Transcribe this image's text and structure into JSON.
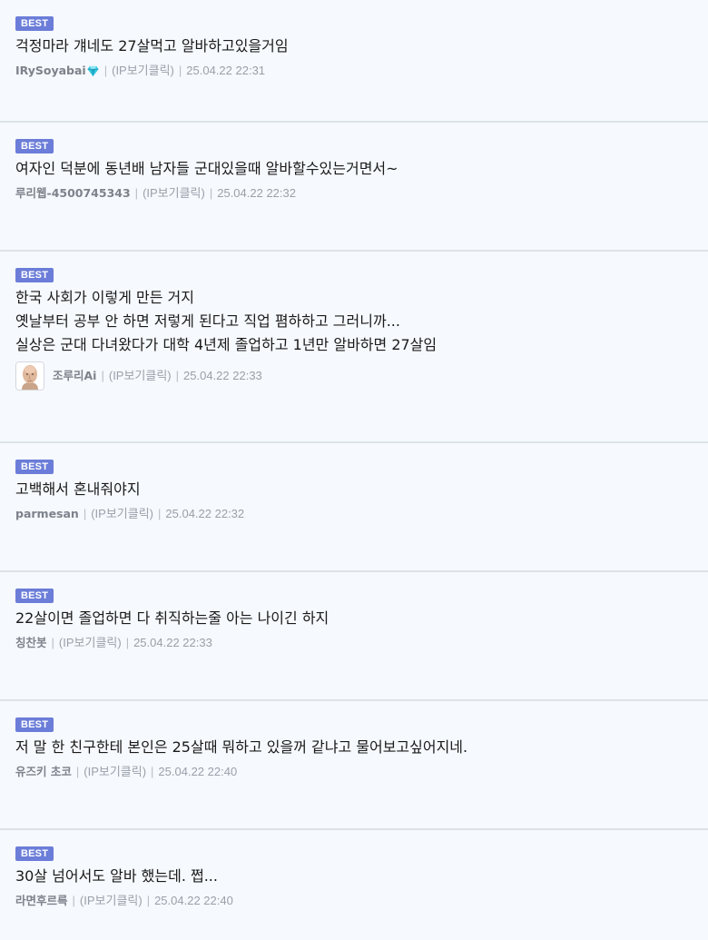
{
  "comments": [
    {
      "badge": "BEST",
      "text": "걱정마라 걔네도 27살먹고 알바하고있을거임",
      "nick": "IRySoyabai",
      "nick_icon": "diamond-icon",
      "ip_label": "(IP보기클릭)",
      "date": "25.04.22 22:31"
    },
    {
      "badge": "BEST",
      "text": "여자인 덕분에 동년배 남자들 군대있을때 알바할수있는거면서~",
      "nick": "루리웹-4500745343",
      "ip_label": "(IP보기클릭)",
      "date": "25.04.22 22:32"
    },
    {
      "badge": "BEST",
      "text": "한국 사회가 이렇게 만든 거지\n옛날부터 공부 안 하면 저렇게 된다고 직업 폄하하고 그러니까...\n실상은 군대 다녀왔다가 대학 4년제 졸업하고 1년만 알바하면 27살임",
      "nick": "조루리Ai",
      "avatar": "bald-man-avatar",
      "ip_label": "(IP보기클릭)",
      "date": "25.04.22 22:33"
    },
    {
      "badge": "BEST",
      "text": "고백해서 혼내줘야지",
      "nick": "parmesan",
      "ip_label": "(IP보기클릭)",
      "date": "25.04.22 22:32"
    },
    {
      "badge": "BEST",
      "text": "22살이면 졸업하면 다 취직하는줄 아는 나이긴 하지",
      "nick": "칭찬봇",
      "ip_label": "(IP보기클릭)",
      "date": "25.04.22 22:33"
    },
    {
      "badge": "BEST",
      "text": "저 말 한 친구한테 본인은 25살때 뭐하고 있을꺼 같냐고 물어보고싶어지네.",
      "nick": "유즈키 초코",
      "ip_label": "(IP보기클릭)",
      "date": "25.04.22 22:40"
    },
    {
      "badge": "BEST",
      "text": "30살 넘어서도 알바 했는데. 쩝...",
      "nick": "라면후르륵",
      "ip_label": "(IP보기클릭)",
      "date": "25.04.22 22:40"
    }
  ],
  "colors": {
    "background": "#f6f9fd",
    "badge": "#6b7dd8",
    "divider": "#dde2ea",
    "meta_text": "#9aa0aa"
  }
}
